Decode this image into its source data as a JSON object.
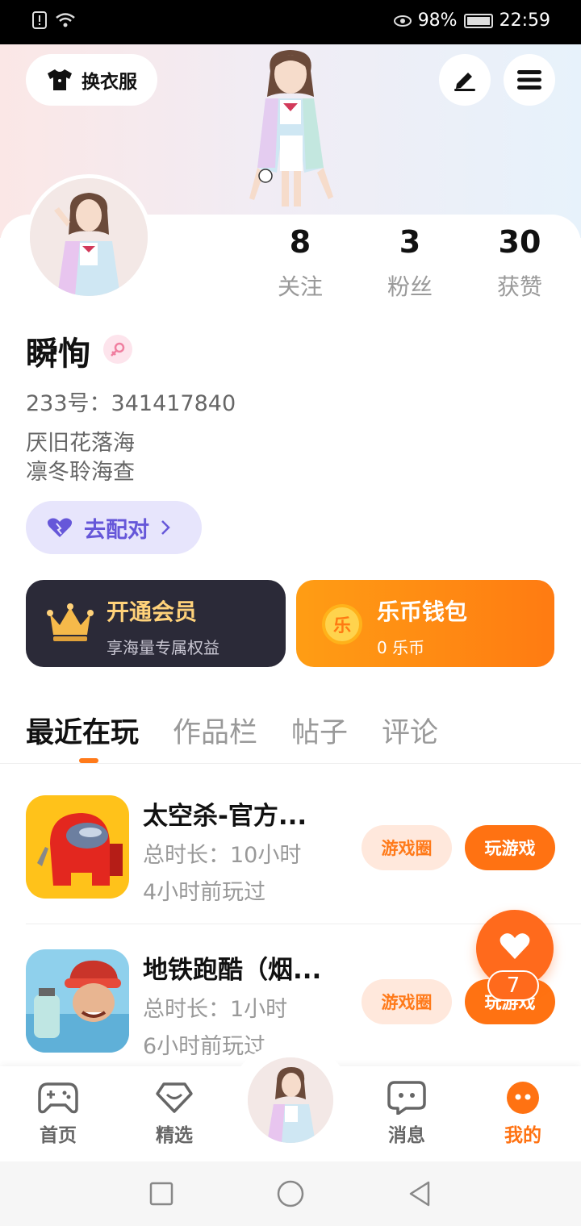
{
  "status_bar": {
    "battery": "98%",
    "time": "22:59"
  },
  "header": {
    "outfit_label": "换衣服"
  },
  "stats": [
    {
      "value": "8",
      "label": "关注"
    },
    {
      "value": "3",
      "label": "粉丝"
    },
    {
      "value": "30",
      "label": "获赞"
    }
  ],
  "profile": {
    "nickname": "瞬恂",
    "uid": "233号：341417840",
    "bio_line1": "厌旧花落海",
    "bio_line2": "凛冬聆海查",
    "match_label": "去配对"
  },
  "cards": {
    "vip_title": "开通会员",
    "vip_sub": "享海量专属权益",
    "wallet_title": "乐币钱包",
    "wallet_sub": "0 乐币",
    "wallet_coin": "乐"
  },
  "tabs": [
    "最近在玩",
    "作品栏",
    "帖子",
    "评论"
  ],
  "games": [
    {
      "name": "太空杀-官方...",
      "duration": "总时长：10小时",
      "last_played": "4小时前玩过",
      "circle_label": "游戏圈",
      "play_label": "玩游戏"
    },
    {
      "name": "地铁跑酷（烟...",
      "duration": "总时长：1小时",
      "last_played": "6小时前玩过",
      "circle_label": "游戏圈",
      "play_label": "玩游戏"
    }
  ],
  "favorite_count": "7",
  "nav": [
    {
      "label": "首页"
    },
    {
      "label": "精选"
    },
    {
      "label": "消息"
    },
    {
      "label": "我的"
    }
  ],
  "colors": {
    "accent": "#ff7212",
    "match": "#6657d9",
    "vip_bg": "#2b2a38"
  }
}
